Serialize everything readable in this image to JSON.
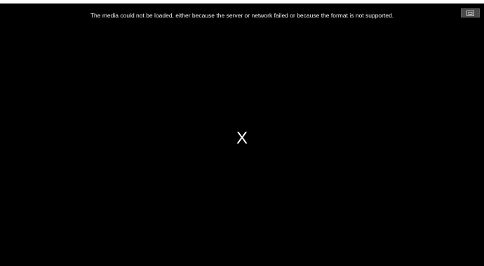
{
  "player": {
    "error_message": "The media could not be loaded, either because the server or network failed or because the format is not supported.",
    "center_icon_text": "X",
    "close_icon": "exit-fullscreen-icon"
  },
  "colors": {
    "background": "#000000",
    "text": "#f2f2f2",
    "button": "#4a4a4a"
  }
}
